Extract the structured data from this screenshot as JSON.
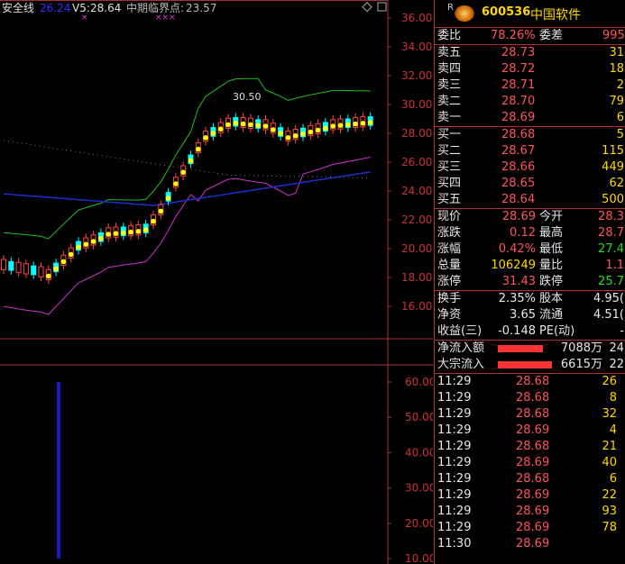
{
  "top_bar": {
    "indicator1_label": "安全线",
    "indicator1_value": "26.24",
    "indicator2_label": "V5:",
    "indicator2_value": "28.64",
    "indicator3_label": "中期临界点:",
    "indicator3_value": "23.57",
    "markers": "×",
    "markers2": "×××"
  },
  "price_axis": [
    "36.00",
    "34.00",
    "32.00",
    "30.00",
    "28.00",
    "26.00",
    "24.00",
    "22.00",
    "20.00",
    "18.00",
    "16.00"
  ],
  "volume_axis": [
    "60.00",
    "50.00",
    "40.00",
    "30.00",
    "20.00",
    "10.00"
  ],
  "peak_label": "30.50",
  "quote": {
    "flag": "R",
    "code": "600536",
    "name": "中国软件",
    "weibi_label": "委比",
    "weibi_value": "78.26%",
    "weicha_label": "委差",
    "weicha_value": "995",
    "sells": [
      {
        "label": "卖五",
        "price": "28.73",
        "vol": "31"
      },
      {
        "label": "卖四",
        "price": "28.72",
        "vol": "18"
      },
      {
        "label": "卖三",
        "price": "28.71",
        "vol": "2"
      },
      {
        "label": "卖二",
        "price": "28.70",
        "vol": "79"
      },
      {
        "label": "卖一",
        "price": "28.69",
        "vol": "6"
      }
    ],
    "buys": [
      {
        "label": "买一",
        "price": "28.68",
        "vol": "5"
      },
      {
        "label": "买二",
        "price": "28.67",
        "vol": "115"
      },
      {
        "label": "买三",
        "price": "28.66",
        "vol": "449"
      },
      {
        "label": "买四",
        "price": "28.65",
        "vol": "62"
      },
      {
        "label": "买五",
        "price": "28.64",
        "vol": "500"
      }
    ],
    "stats": [
      {
        "l1": "现价",
        "v1": "28.69",
        "l2": "今开",
        "v2": "28.3"
      },
      {
        "l1": "涨跌",
        "v1": "0.12",
        "l2": "最高",
        "v2": "28.7"
      },
      {
        "l1": "涨幅",
        "v1": "0.42%",
        "l2": "最低",
        "v2": "27.4"
      },
      {
        "l1": "总量",
        "v1": "106249",
        "l2": "量比",
        "v2": "1.1"
      },
      {
        "l1": "涨停",
        "v1": "31.43",
        "l2": "跌停",
        "v2": "25.7"
      }
    ],
    "fund": [
      {
        "l1": "换手",
        "v1": "2.35%",
        "l2": "股本",
        "v2": "4.95("
      },
      {
        "l1": "净资",
        "v1": "3.65",
        "l2": "流通",
        "v2": "4.51("
      },
      {
        "l1": "收益(三)",
        "v1": "-0.148",
        "l2": "PE(动)",
        "v2": "-"
      }
    ],
    "flows": [
      {
        "label": "净流入额",
        "value": "7088万",
        "extra": "24"
      },
      {
        "label": "大宗流入",
        "value": "6615万",
        "extra": "22"
      }
    ],
    "ticks": [
      {
        "time": "11:29",
        "price": "28.68",
        "vol": "26"
      },
      {
        "time": "11:29",
        "price": "28.68",
        "vol": "8"
      },
      {
        "time": "11:29",
        "price": "28.68",
        "vol": "32"
      },
      {
        "time": "11:29",
        "price": "28.69",
        "vol": "4"
      },
      {
        "time": "11:29",
        "price": "28.68",
        "vol": "21"
      },
      {
        "time": "11:29",
        "price": "28.69",
        "vol": "40"
      },
      {
        "time": "11:29",
        "price": "28.68",
        "vol": "6"
      },
      {
        "time": "11:29",
        "price": "28.69",
        "vol": "22"
      },
      {
        "time": "11:29",
        "price": "28.69",
        "vol": "93"
      },
      {
        "time": "11:29",
        "price": "28.69",
        "vol": "78"
      },
      {
        "time": "11:30",
        "price": "28.69",
        "vol": ""
      }
    ]
  },
  "colors": {
    "up": "#ff4444",
    "down": "#00ffff",
    "boll_upper": "#1fbf1f",
    "boll_lower": "#cc33cc",
    "ma_blue": "#1a2fcc",
    "dots": "#ffff00",
    "grid": "#a33333"
  }
}
